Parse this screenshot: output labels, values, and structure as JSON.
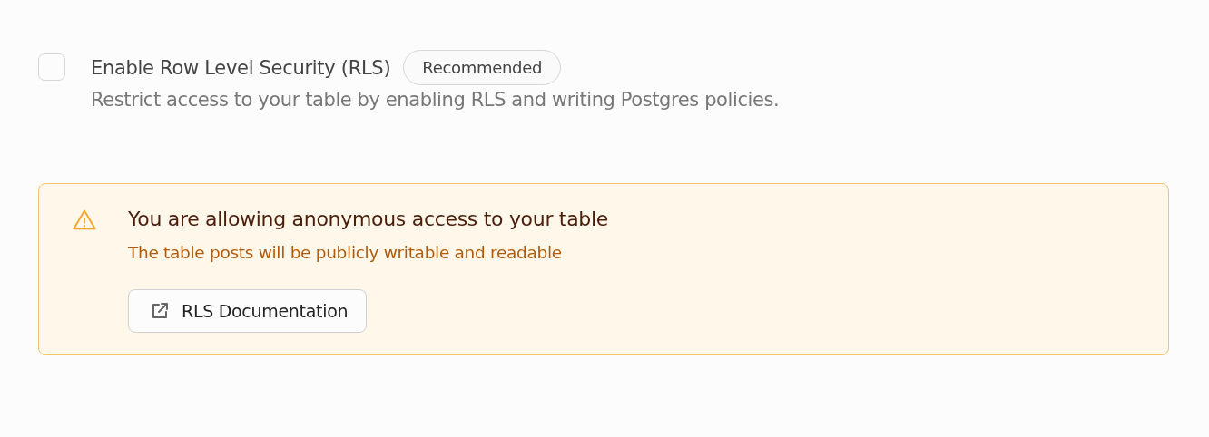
{
  "rls_option": {
    "checked": false,
    "label": "Enable Row Level Security (RLS)",
    "badge": "Recommended",
    "description": "Restrict access to your table by enabling RLS and writing Postgres policies."
  },
  "warning": {
    "title": "You are allowing anonymous access to your table",
    "message": "The table posts will be publicly writable and readable",
    "button": "RLS Documentation"
  }
}
